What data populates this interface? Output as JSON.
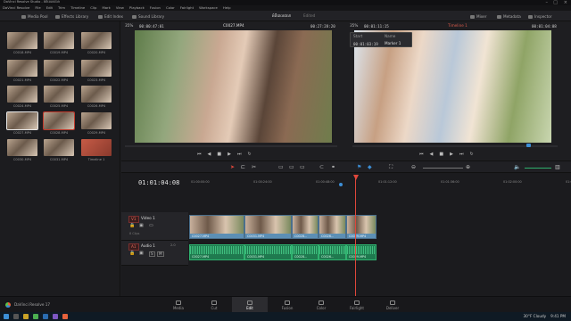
{
  "window": {
    "title": "DaVinci Resolve Studio - អំពីពេលវេលា"
  },
  "menu": [
    "DaVinci Resolve",
    "File",
    "Edit",
    "Trim",
    "Timeline",
    "Clip",
    "Mark",
    "View",
    "Playback",
    "Fusion",
    "Color",
    "Fairlight",
    "Workspace",
    "Help"
  ],
  "toolbar": {
    "media_pool": "Media Pool",
    "effects_library": "Effects Library",
    "edit_index": "Edit Index",
    "sound_library": "Sound Library",
    "project_title": "អំពីពេលវេលា",
    "project_status": "Edited",
    "mixer": "Mixer",
    "metadata": "Metadata",
    "inspector": "Inspector"
  },
  "source_viewer": {
    "zoom": "35%",
    "timecode": "00:00:47:01",
    "clip_name": "C0027.MP4",
    "duration": "00:27:28:20"
  },
  "timeline_viewer": {
    "zoom": "35%",
    "duration": "00:01:11:15",
    "timeline_name": "Timeline 1",
    "timecode": "00:01:04:08"
  },
  "marker_popup": {
    "col1": "Start",
    "col2": "Name",
    "start": "00:01:03:19",
    "name": "Marker 1"
  },
  "media_pool": {
    "clips": [
      "C0018.MP4",
      "C0019.MP4",
      "C0020.MP4",
      "C0021.MP4",
      "C0022.MP4",
      "C0023.MP4",
      "C0024.MP4",
      "C0025.MP4",
      "C0026.MP4",
      "C0027.MP4",
      "C0028.MP4",
      "C0029.MP4",
      "C0030.MP4",
      "C0031.MP4",
      "Timeline 1"
    ]
  },
  "timeline": {
    "current_timecode": "01:01:04:08",
    "ruler": [
      "01:00:00:00",
      "01:00:24:00",
      "01:00:48:00",
      "01:01:12:00",
      "01:01:36:00",
      "01:02:00:00",
      "01:02:24:00"
    ],
    "video_track": {
      "id": "V1",
      "name": "Video 1",
      "clip_count": "8 Clips"
    },
    "audio_track": {
      "id": "A1",
      "name": "Audio 1",
      "level": "2.0"
    },
    "video_clips": [
      "C0027.MP4",
      "C0031.MP4",
      "C0028...",
      "C0026...",
      "C0029.MP4"
    ],
    "audio_clips": [
      "C0027.MP4",
      "C0031.MP4",
      "C0028...",
      "C0026...",
      "C0029.MP4"
    ]
  },
  "pages": [
    "Media",
    "Cut",
    "Edit",
    "Fusion",
    "Color",
    "Fairlight",
    "Deliver"
  ],
  "active_page": "Edit",
  "footer": {
    "app_name": "DaVinci Resolve 17"
  },
  "taskbar": {
    "weather": "30°F Cloudy",
    "time": "9:41 PM"
  },
  "colors": {
    "playhead": "#e0473b",
    "video_clip": "#5c8fb5",
    "audio_clip": "#2fb06e",
    "accent": "#e6623c"
  }
}
